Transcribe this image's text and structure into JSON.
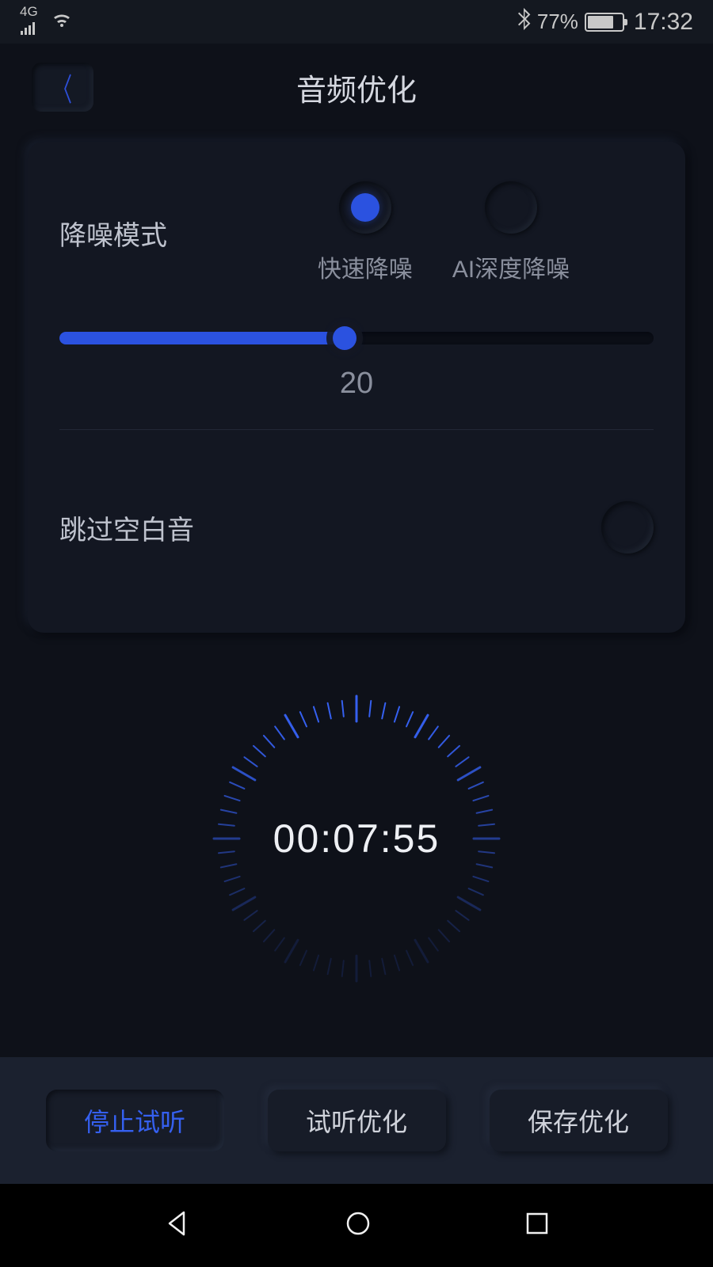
{
  "statusBar": {
    "network": "4G",
    "batteryPercent": "77%",
    "time": "17:32"
  },
  "header": {
    "title": "音频优化"
  },
  "noiseReduction": {
    "label": "降噪模式",
    "options": {
      "fast": "快速降噪",
      "aiDeep": "AI深度降噪"
    },
    "sliderValue": "20"
  },
  "skipSilence": {
    "label": "跳过空白音"
  },
  "timer": {
    "display": "00:07:55"
  },
  "buttons": {
    "stopPreview": "停止试听",
    "previewOptimize": "试听优化",
    "saveOptimize": "保存优化"
  }
}
